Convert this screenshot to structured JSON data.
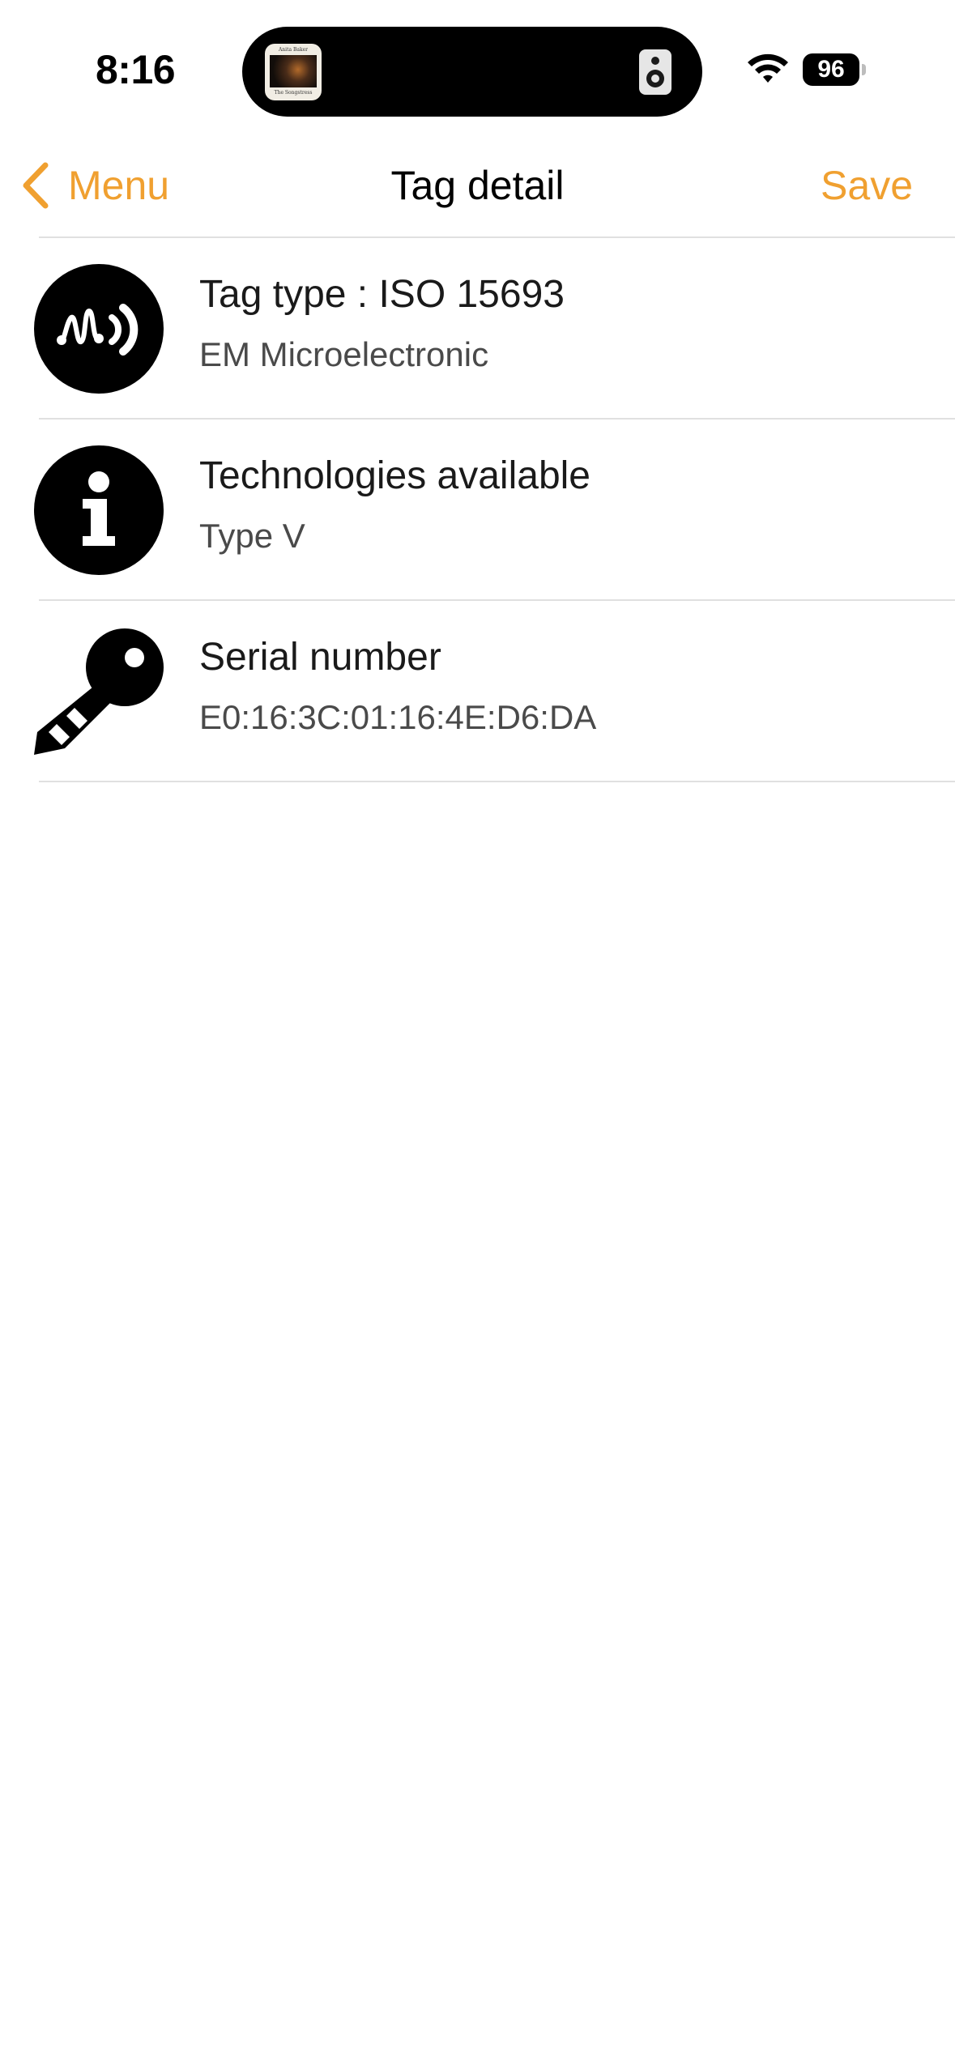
{
  "status_bar": {
    "time": "8:16",
    "battery_level": "96",
    "now_playing_art": {
      "top_text": "Anita Baker",
      "bottom_text": "The Songstress"
    }
  },
  "nav": {
    "back_label": "Menu",
    "title": "Tag detail",
    "save_label": "Save",
    "accent_color": "#f0a030"
  },
  "rows": [
    {
      "icon": "nfc-tag-icon",
      "title": "Tag type : ISO 15693",
      "subtitle": "EM Microelectronic"
    },
    {
      "icon": "info-icon",
      "title": "Technologies available",
      "subtitle": "Type V"
    },
    {
      "icon": "key-icon",
      "title": "Serial number",
      "subtitle": "E0:16:3C:01:16:4E:D6:DA"
    }
  ]
}
